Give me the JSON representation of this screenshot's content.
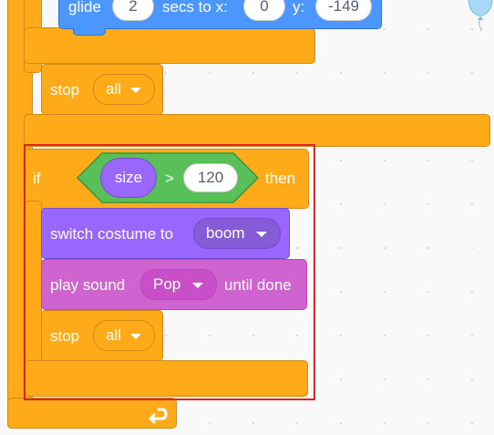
{
  "glide": {
    "label": "glide",
    "secs_value": "2",
    "secs_to_x_label": "secs to x:",
    "x_value": "0",
    "y_label": "y:",
    "y_value": "-149"
  },
  "stop_top": {
    "label": "stop",
    "option": "all"
  },
  "if_block": {
    "if_label": "if",
    "then_label": "then"
  },
  "condition": {
    "reporter": "size",
    "operator": ">",
    "value": "120"
  },
  "switch_costume": {
    "label": "switch costume to",
    "option": "boom"
  },
  "play_sound": {
    "label": "play sound",
    "option": "Pop",
    "suffix": "until done"
  },
  "stop_inner": {
    "label": "stop",
    "option": "all"
  },
  "colors": {
    "control": "#ffab19",
    "motion": "#4c97ff",
    "looks": "#9966ff",
    "sound": "#cf63cf",
    "operators": "#59c059",
    "highlight": "#e42222"
  },
  "icons": {
    "loop_arrow": "loop-arrow-icon",
    "balloon": "balloon-icon"
  }
}
